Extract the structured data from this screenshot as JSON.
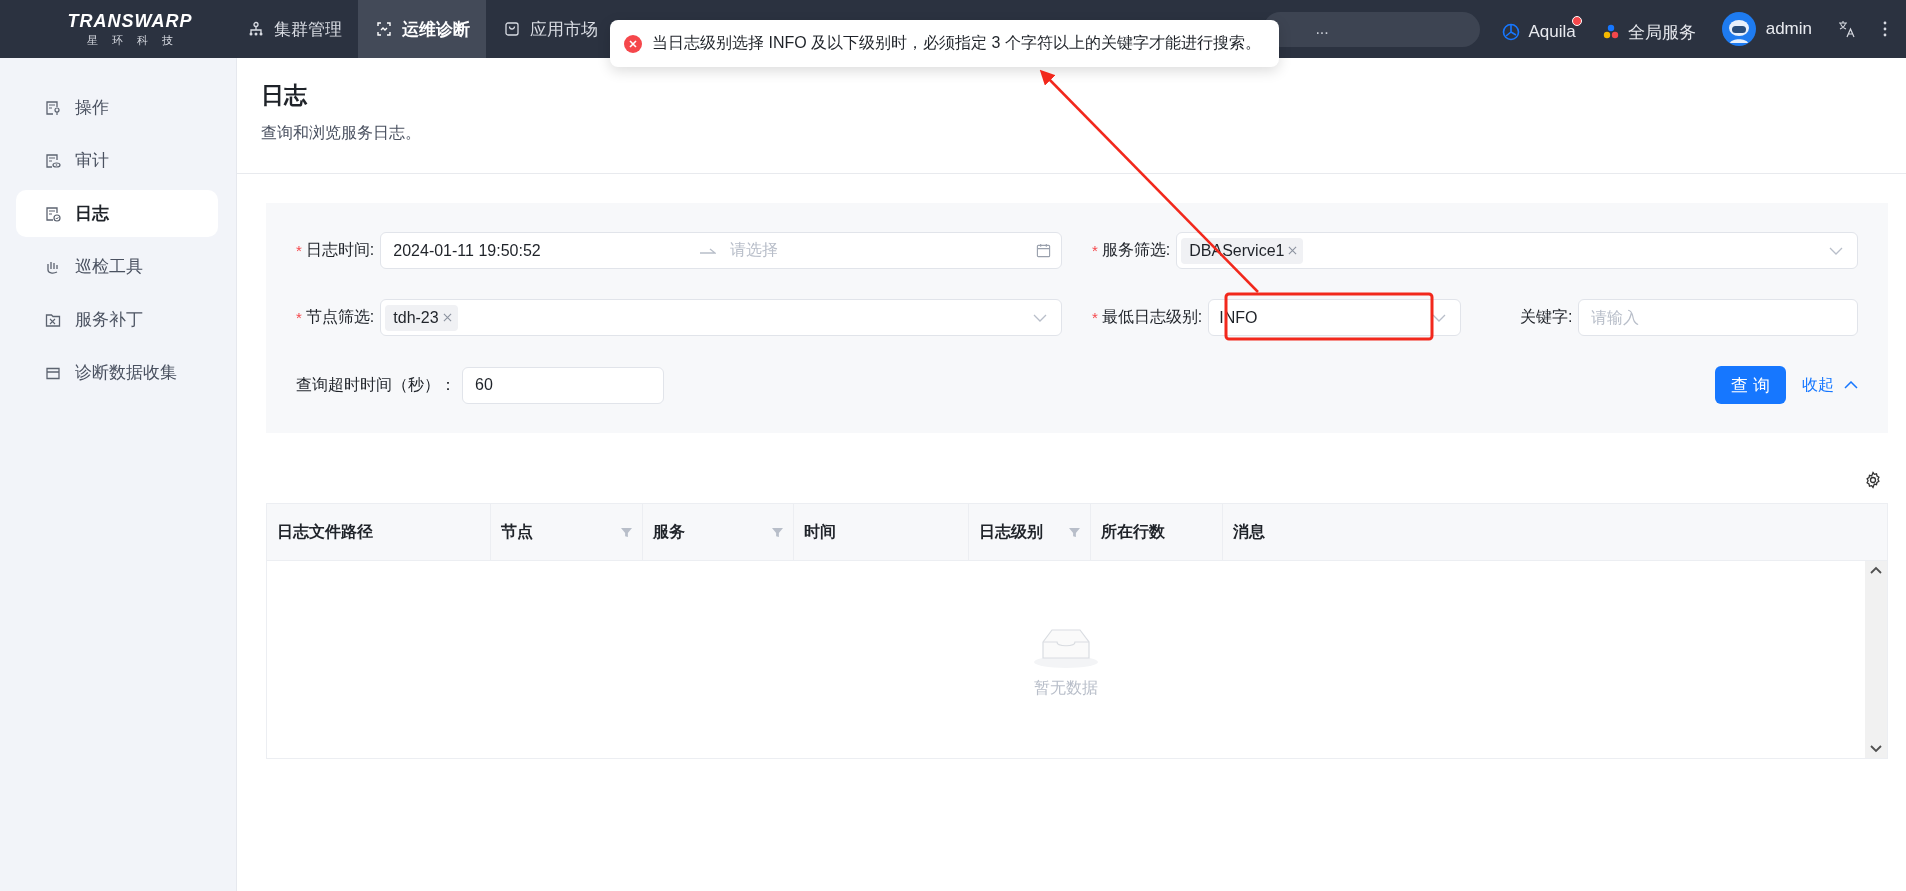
{
  "header": {
    "logo": {
      "brand": "TRANSWARP",
      "subtitle": "星环科技"
    },
    "nav": [
      {
        "label": "集群管理",
        "selected": false
      },
      {
        "label": "运维诊断",
        "selected": true
      },
      {
        "label": "应用市场",
        "selected": false
      }
    ],
    "search": {
      "placeholder": "..."
    },
    "actions": [
      {
        "label": "Aquila",
        "notification": true
      },
      {
        "label": "全局服务",
        "notification": false
      }
    ],
    "user": {
      "name": "admin"
    }
  },
  "toast": {
    "kind": "error",
    "message": "当日志级别选择 INFO 及以下级别时，必须指定 3 个字符以上的关键字才能进行搜索。"
  },
  "sidebar": {
    "items": [
      {
        "label": "操作",
        "selected": false
      },
      {
        "label": "审计",
        "selected": false
      },
      {
        "label": "日志",
        "selected": true
      },
      {
        "label": "巡检工具",
        "selected": false
      },
      {
        "label": "服务补丁",
        "selected": false
      },
      {
        "label": "诊断数据收集",
        "selected": false
      }
    ]
  },
  "page": {
    "title": "日志",
    "description": "查询和浏览服务日志。"
  },
  "form": {
    "fields": [
      {
        "kind": "date_range",
        "label": "日志时间:",
        "required": true,
        "value": "2024-01-11 19:50:52",
        "placeholder": "请选择"
      },
      {
        "kind": "select",
        "label": "服务筛选:",
        "required": true,
        "tags": [
          "DBAService1"
        ]
      },
      {
        "kind": "select",
        "label": "节点筛选:",
        "required": true,
        "tags": [
          "tdh-23"
        ]
      },
      {
        "kind": "select",
        "label": "最低日志级别:",
        "required": true,
        "value": "INFO"
      },
      {
        "kind": "input",
        "label": "关键字:",
        "required": false,
        "placeholder": "请输入"
      },
      {
        "kind": "input",
        "label": "查询超时时间（秒）：",
        "required": false,
        "value": "60"
      }
    ],
    "required_mark": "*",
    "submit": "查 询",
    "collapse": "收起"
  },
  "table": {
    "columns": [
      {
        "label": "日志文件路径",
        "filterable": false
      },
      {
        "label": "节点",
        "filterable": true
      },
      {
        "label": "服务",
        "filterable": true
      },
      {
        "label": "时间",
        "filterable": false
      },
      {
        "label": "日志级别",
        "filterable": true
      },
      {
        "label": "所在行数",
        "filterable": false
      },
      {
        "label": "消息",
        "filterable": false
      }
    ],
    "empty_text": "暂无数据"
  },
  "annotations": [
    {
      "kind": "box"
    },
    {
      "kind": "arrow"
    }
  ]
}
